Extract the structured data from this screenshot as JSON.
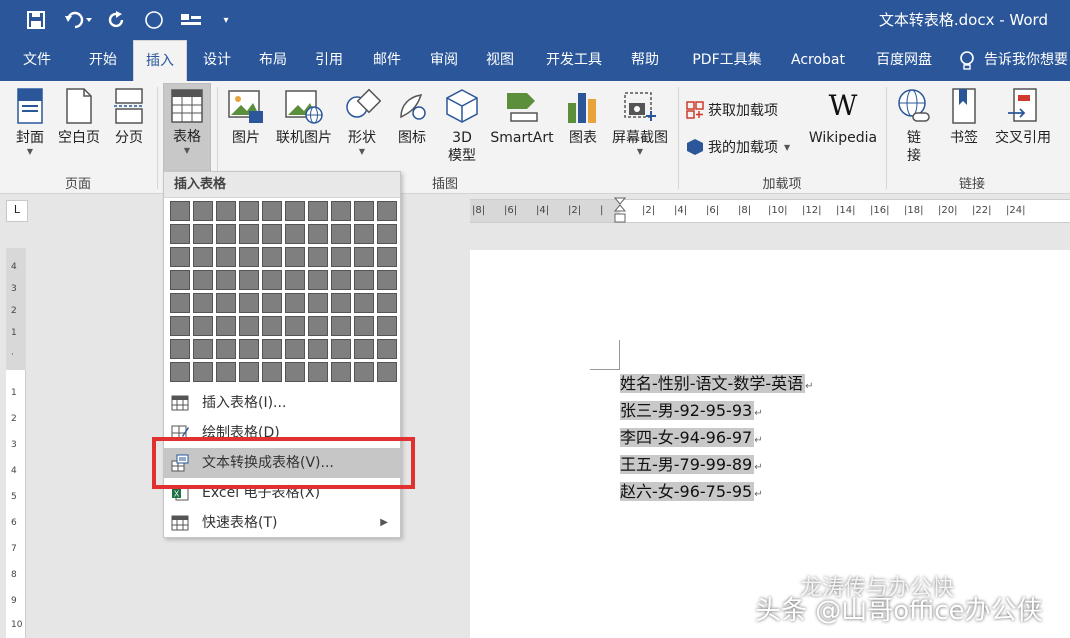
{
  "window": {
    "title": "文本转表格.docx  -  Word"
  },
  "tabs": [
    "文件",
    "开始",
    "插入",
    "设计",
    "布局",
    "引用",
    "邮件",
    "审阅",
    "视图",
    "开发工具",
    "帮助",
    "PDF工具集",
    "Acrobat",
    "百度网盘",
    "告诉我你想要"
  ],
  "ribbon": {
    "pages": {
      "cover": "封面",
      "blank": "空白页",
      "break": "分页",
      "group": "页面"
    },
    "table": {
      "label": "表格"
    },
    "illustrations": {
      "picture": "图片",
      "online_picture": "联机图片",
      "shapes": "形状",
      "icons": "图标",
      "model3d_line1": "3D",
      "model3d_line2": "模型",
      "smartart": "SmartArt",
      "chart": "图表",
      "screenshot": "屏幕截图",
      "group": "插图"
    },
    "addins": {
      "get": "获取加载项",
      "mine": "我的加载项",
      "wikipedia": "Wikipedia",
      "group": "加载项"
    },
    "links": {
      "link_line1": "链",
      "link_line2": "接",
      "bookmark": "书签",
      "crossref": "交叉引用",
      "group": "链接"
    }
  },
  "dropdown": {
    "header": "插入表格",
    "items": [
      {
        "label": "插入表格(I)..."
      },
      {
        "label": "绘制表格(D)"
      },
      {
        "label": "文本转换成表格(V)..."
      },
      {
        "label": "Excel 电子表格(X)"
      },
      {
        "label": "快速表格(T)"
      }
    ]
  },
  "document": {
    "lines": [
      "姓名-性别-语文-数学-英语",
      "张三-男-92-95-93",
      "李四-女-94-96-97",
      "王五-男-79-99-89",
      "赵六-女-96-75-95"
    ]
  },
  "watermark": {
    "line1": "龙涛传与办公快",
    "line2": "头条 @山哥office办公侠"
  },
  "colors": {
    "accent": "#2b579a",
    "highlight_box": "#e0302f"
  }
}
